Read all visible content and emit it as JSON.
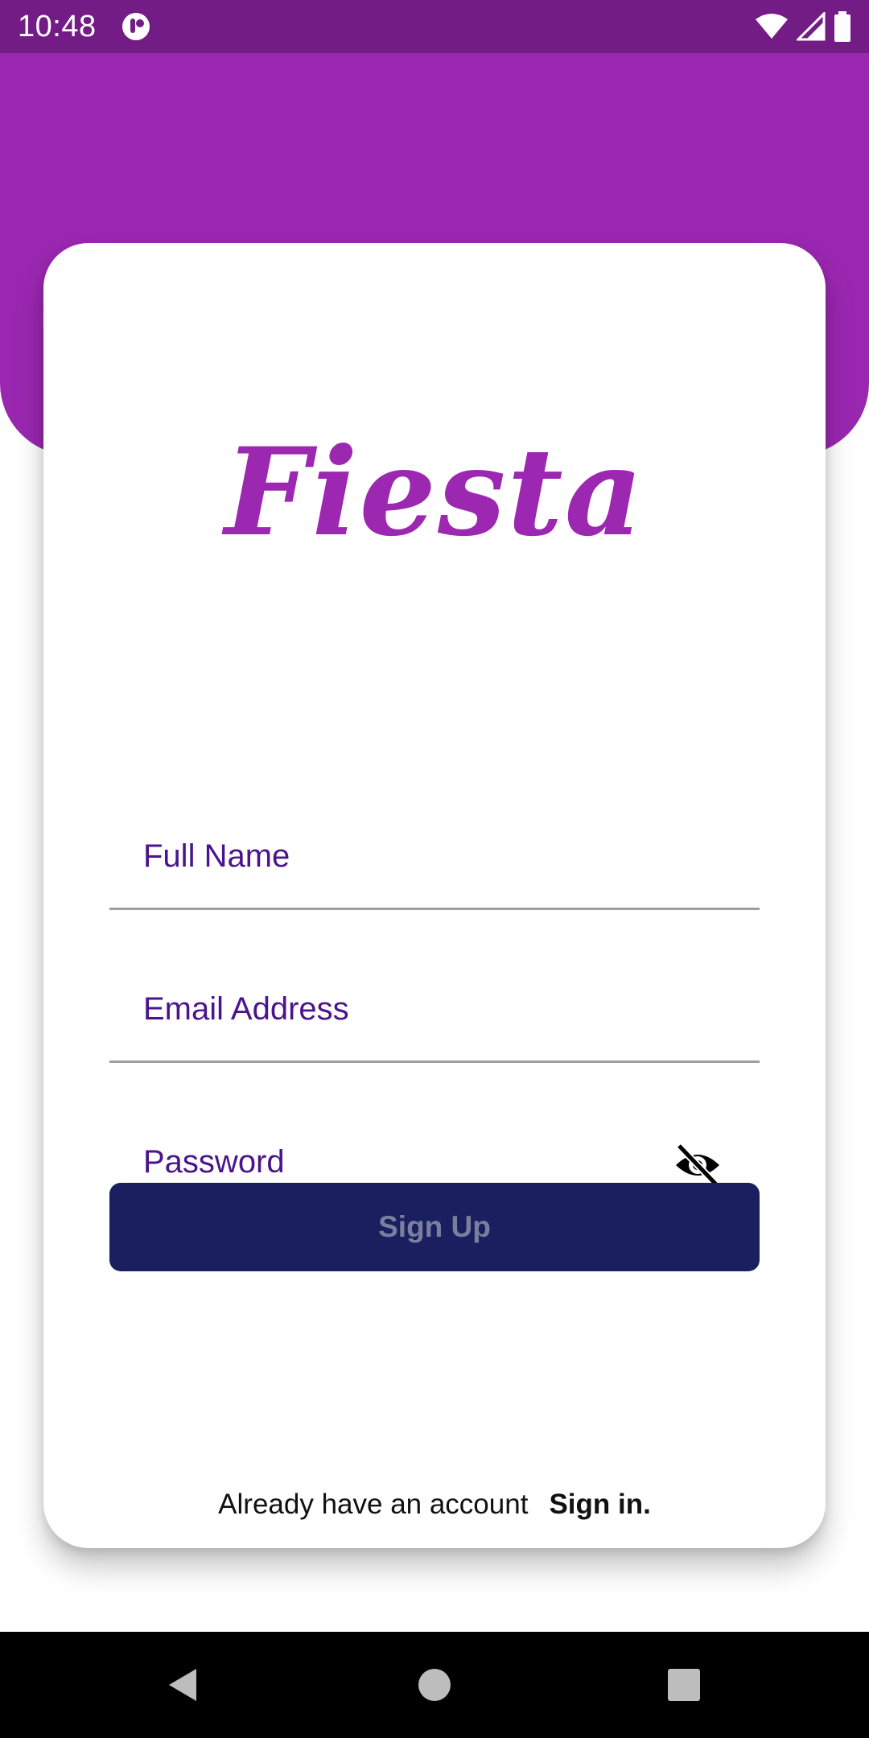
{
  "status_bar": {
    "time": "10:48",
    "icons": [
      "app-notification-icon",
      "wifi-icon",
      "cell-signal-icon",
      "battery-icon"
    ]
  },
  "app": {
    "logo_text": "Fiesta",
    "colors": {
      "header": "#9a27b0",
      "status_bar": "#741c86",
      "logo": "#9c27b0",
      "field_label": "#4a148c",
      "button_bg": "#1a205f",
      "button_text": "#7b7f9e"
    }
  },
  "form": {
    "full_name": {
      "placeholder": "Full Name",
      "value": ""
    },
    "email": {
      "placeholder": "Email Address",
      "value": ""
    },
    "password": {
      "placeholder": "Password",
      "value": "",
      "visibility_icon": "eye-off-icon"
    },
    "submit_label": "Sign Up"
  },
  "footer": {
    "prompt": "Already have an account",
    "link": "Sign in."
  },
  "nav_bar": {
    "buttons": [
      "back-icon",
      "home-icon",
      "recents-icon"
    ]
  }
}
